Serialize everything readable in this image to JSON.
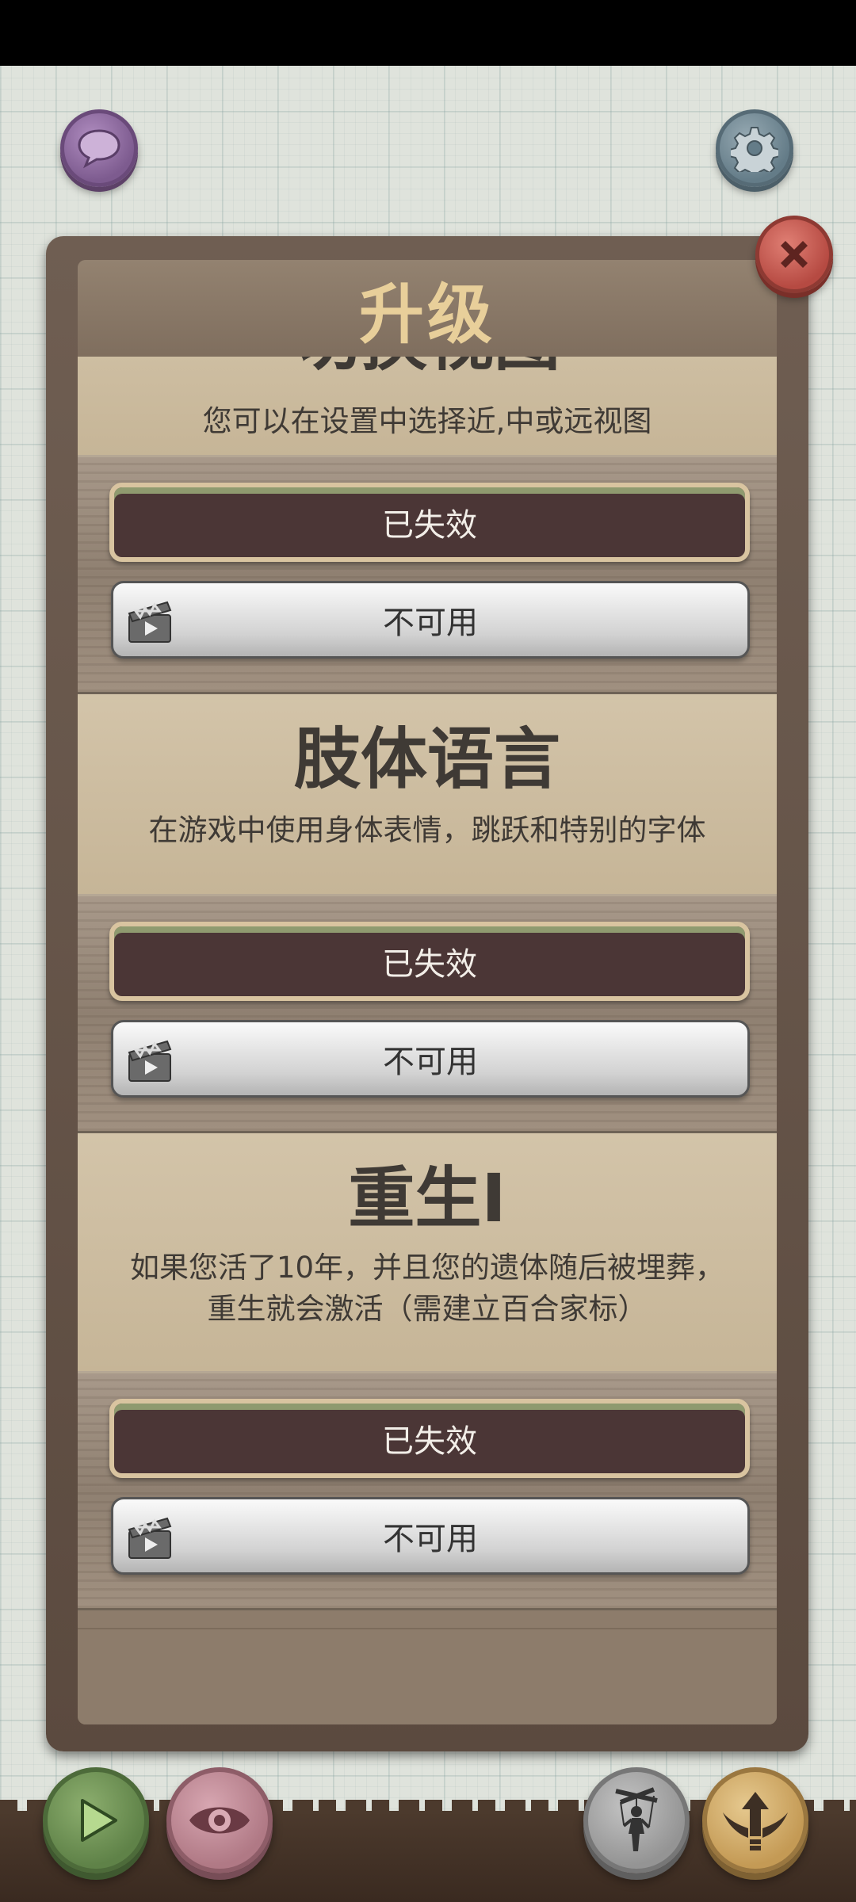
{
  "header": {
    "chat_icon": "speech-bubble-icon",
    "settings_icon": "gear-icon"
  },
  "dialog": {
    "title": "升级",
    "close_icon": "close-x-icon",
    "items": [
      {
        "title": "切换视图",
        "description": "您可以在设置中选择近,中或远视图",
        "status_label": "已失效",
        "video_label": "不可用"
      },
      {
        "title": "肢体语言",
        "description": "在游戏中使用身体表情，跳跃和特别的字体",
        "status_label": "已失效",
        "video_label": "不可用"
      },
      {
        "title": "重生I",
        "description_line1": "如果您活了10年，并且您的遗体随后被埋葬，",
        "description_line2": "重生就会激活（需建立百合家标）",
        "status_label": "已失效",
        "video_label": "不可用"
      }
    ]
  },
  "bottom_bar": {
    "play_icon": "play-icon",
    "eye_icon": "eye-icon",
    "puppet_icon": "marionette-icon",
    "upgrade_icon": "winged-arrow-icon"
  },
  "colors": {
    "frame": "#5b4a3f",
    "title_text": "#e8cf9a",
    "card_bg": "#c6b597",
    "disabled_button": "#4b3636"
  }
}
